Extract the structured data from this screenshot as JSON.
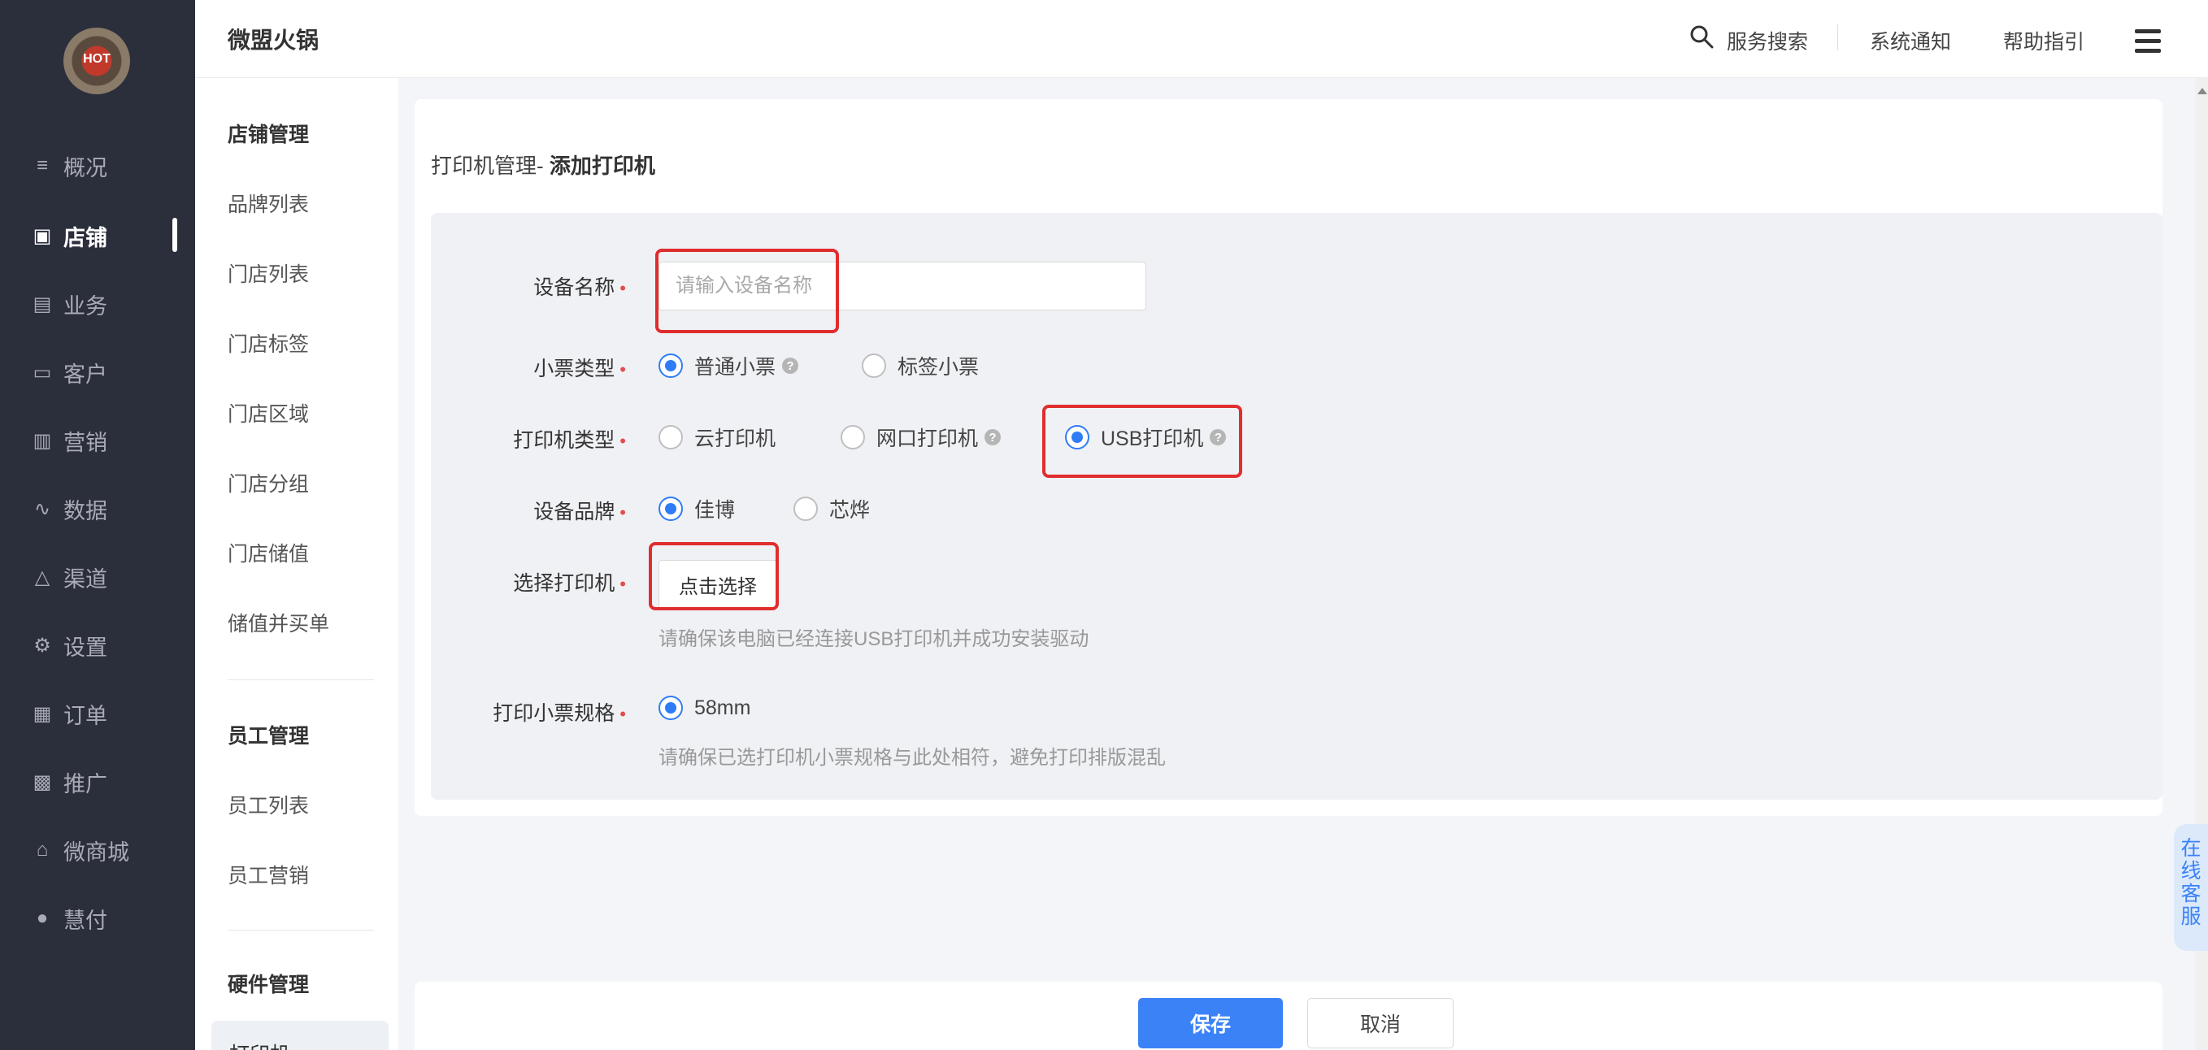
{
  "nav": {
    "avatar_text": "HOT",
    "items": [
      {
        "label": "概况",
        "icon": "overview-icon"
      },
      {
        "label": "店铺",
        "icon": "store-icon"
      },
      {
        "label": "业务",
        "icon": "business-icon"
      },
      {
        "label": "客户",
        "icon": "customer-icon"
      },
      {
        "label": "营销",
        "icon": "marketing-icon"
      },
      {
        "label": "数据",
        "icon": "data-icon"
      },
      {
        "label": "渠道",
        "icon": "channel-icon"
      },
      {
        "label": "设置",
        "icon": "settings-icon"
      },
      {
        "label": "订单",
        "icon": "order-icon"
      },
      {
        "label": "推广",
        "icon": "promotion-icon"
      },
      {
        "label": "微商城",
        "icon": "mall-icon"
      },
      {
        "label": "慧付",
        "icon": "pay-icon"
      }
    ],
    "active": "店铺"
  },
  "topbar": {
    "title": "微盟火锅",
    "search": "服务搜索",
    "notice": "系统通知",
    "help": "帮助指引"
  },
  "subnav": {
    "group1": "店铺管理",
    "group1_items": [
      "品牌列表",
      "门店列表",
      "门店标签",
      "门店区域",
      "门店分组",
      "门店储值",
      "储值并买单"
    ],
    "group2": "员工管理",
    "group2_items": [
      "员工列表",
      "员工营销"
    ],
    "group3": "硬件管理",
    "group3_selected": "打印机"
  },
  "page": {
    "crumb_prefix": "打印机管理-",
    "crumb_current": "添加打印机"
  },
  "form": {
    "device_name_label": "设备名称",
    "device_name_placeholder": "请输入设备名称",
    "device_name_value": "",
    "ticket_type_label": "小票类型",
    "ticket_type_options": [
      "普通小票",
      "标签小票"
    ],
    "ticket_type_selected": "普通小票",
    "printer_type_label": "打印机类型",
    "printer_type_options": [
      "云打印机",
      "网口打印机",
      "USB打印机"
    ],
    "printer_type_selected": "USB打印机",
    "brand_label": "设备品牌",
    "brand_options": [
      "佳博",
      "芯烨"
    ],
    "brand_selected": "佳博",
    "select_printer_label": "选择打印机",
    "select_printer_button": "点击选择",
    "select_printer_hint": "请确保该电脑已经连接USB打印机并成功安装驱动",
    "spec_label": "打印小票规格",
    "spec_option": "58mm",
    "spec_hint": "请确保已选打印机小票规格与此处相符，避免打印排版混乱",
    "required_mark": "•"
  },
  "footer": {
    "save": "保存",
    "cancel": "取消"
  },
  "service": "在线客服",
  "colors": {
    "nav_bg": "#2b2e3b",
    "primary": "#3b82f6",
    "highlight_box": "#e02d2d",
    "required": "#e34d4d"
  }
}
